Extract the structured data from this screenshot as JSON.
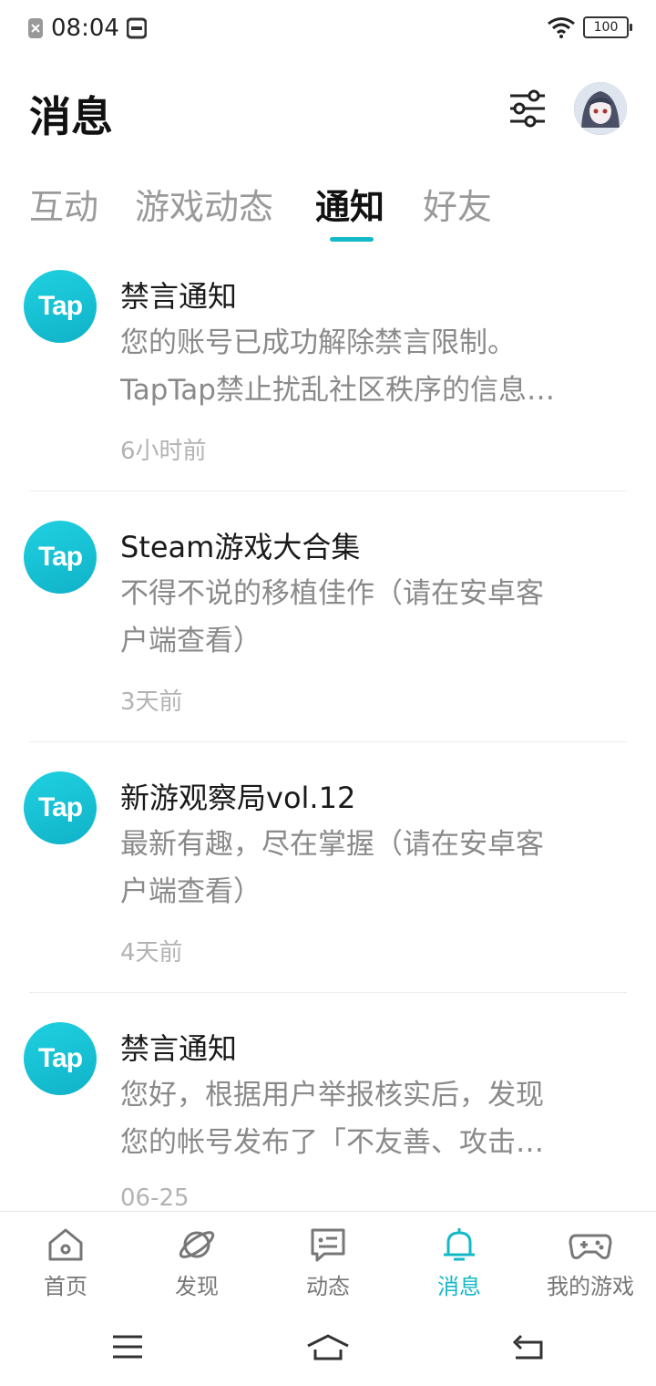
{
  "status_bar": {
    "time": "08:04",
    "battery": "100"
  },
  "header": {
    "title": "消息"
  },
  "tabs": [
    {
      "label": "互动"
    },
    {
      "label": "游戏动态"
    },
    {
      "label": "通知"
    },
    {
      "label": "好友"
    }
  ],
  "active_tab": "通知",
  "notifications": [
    {
      "logo": "Tap",
      "title": "禁言通知",
      "body_lines": [
        "您的账号已成功解除禁言限制。",
        "TapTap禁止扰乱社区秩序的信息…"
      ],
      "time": "6小时前"
    },
    {
      "logo": "Tap",
      "title": "Steam游戏大合集",
      "body_lines": [
        "不得不说的移植佳作（请在安卓客",
        "户端查看）"
      ],
      "time": "3天前"
    },
    {
      "logo": "Tap",
      "title": "新游观察局vol.12",
      "body_lines": [
        "最新有趣，尽在掌握（请在安卓客",
        "户端查看）"
      ],
      "time": "4天前"
    },
    {
      "logo": "Tap",
      "title": "禁言通知",
      "body_lines": [
        "您好，根据用户举报核实后，发现",
        "您的帐号发布了「不友善、攻击…"
      ],
      "time": "06-25"
    }
  ],
  "bottom_nav": [
    {
      "label": "首页",
      "icon": "home-icon"
    },
    {
      "label": "发现",
      "icon": "planet-icon"
    },
    {
      "label": "动态",
      "icon": "chat-icon"
    },
    {
      "label": "消息",
      "icon": "bell-icon"
    },
    {
      "label": "我的游戏",
      "icon": "gamepad-icon"
    }
  ],
  "active_bottom_nav": "消息",
  "colors": {
    "accent": "#14b9c8"
  }
}
